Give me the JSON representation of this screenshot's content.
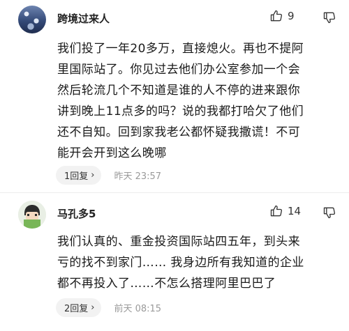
{
  "comments": [
    {
      "username": "跨境过来人",
      "likes": "9",
      "text_lines": [
        "我们投了一年20多万，直接熄火。再也不提阿",
        "里国际站了。你见过去他们办公室参加一个会",
        "然后轮流几个不知道是谁的人不停的进来跟你",
        "讲到晚上11点多的吗？说的我都打哈欠了他们",
        "还不自知。回到家我老公都怀疑我撒谎！不可",
        "能开会开到这么晚哪"
      ],
      "replies": "1回复",
      "reply_arrow": "›",
      "time": "昨天 23:57"
    },
    {
      "username": "马孔多5",
      "likes": "14",
      "text_lines": [
        "我们认真的、重金投资国际站四五年，到头来",
        "亏的找不到家门…… 我身边所有我知道的企业",
        "都不再投入了……不怎么搭理阿里巴巴了"
      ],
      "replies": "2回复",
      "reply_arrow": "›",
      "time": "前天 08:15"
    }
  ],
  "icons": {
    "like": "thumbs-up-outline",
    "dislike": "thumbs-down-outline"
  }
}
